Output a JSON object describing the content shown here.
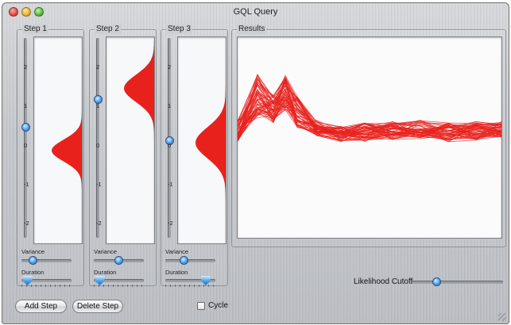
{
  "window": {
    "title": "GQL Query"
  },
  "steps": [
    {
      "label": "Step 1",
      "mean_knob": 0.5,
      "gauss": {
        "mean": -0.1,
        "sd": 0.28
      },
      "ticks": [
        "2",
        "1",
        "0",
        "-1",
        "-2"
      ],
      "variance_label": "Variance",
      "variance_value": 0.18,
      "duration_label": "Duration",
      "duration_value": 0.03
    },
    {
      "label": "Step 2",
      "mean_knob": 1.2,
      "gauss": {
        "mean": 1.5,
        "sd": 0.35
      },
      "ticks": [
        "2",
        "1",
        "0",
        "-1",
        "-2"
      ],
      "variance_label": "Variance",
      "variance_value": 0.5,
      "duration_label": "Duration",
      "duration_value": 0.03
    },
    {
      "label": "Step 3",
      "mean_knob": 0.15,
      "gauss": {
        "mean": 0.1,
        "sd": 0.4
      },
      "ticks": [
        "2",
        "1",
        "0",
        "-1",
        "-2"
      ],
      "variance_label": "Variance",
      "variance_value": 0.35,
      "duration_label": "Duration",
      "duration_value": 0.88
    }
  ],
  "results": {
    "label": "Results",
    "line_color": "#e8211d",
    "series_count": 60
  },
  "likelihood": {
    "label": "Likelihood Cutoff",
    "value": 0.25
  },
  "buttons": {
    "add": "Add Step",
    "delete": "Delete Step"
  },
  "cycle": {
    "label": "Cycle",
    "checked": false
  },
  "colors": {
    "accent": "#e8211d",
    "knob": "#4aa0e6"
  }
}
